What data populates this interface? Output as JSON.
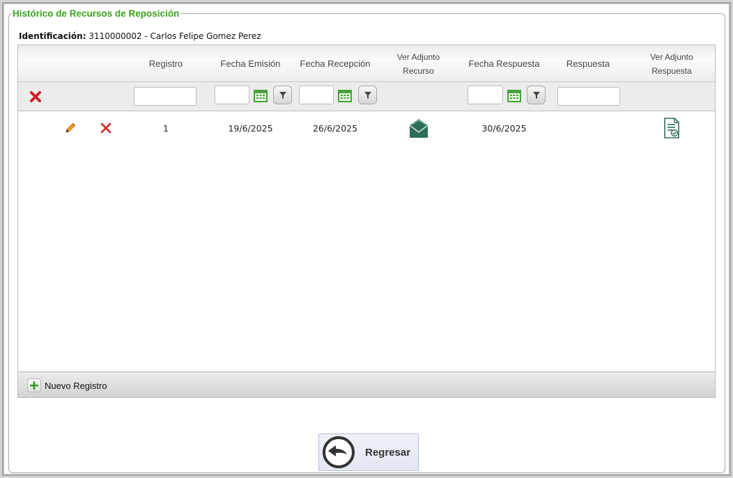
{
  "panel": {
    "title": "Histórico de Recursos de Reposición",
    "identification_label": "Identificación:",
    "identification_value": "3110000002 - Carlos Felipe Gomez Perez"
  },
  "grid": {
    "columns": {
      "registro": "Registro",
      "fecha_emision": "Fecha Emisión",
      "fecha_recepcion": "Fecha Recepción",
      "ver_adjunto_recurso_1": "Ver Adjunto",
      "ver_adjunto_recurso_2": "Recurso",
      "fecha_respuesta": "Fecha Respuesta",
      "respuesta": "Respuesta",
      "ver_adjunto_respuesta_1": "Ver Adjunto",
      "ver_adjunto_respuesta_2": "Respuesta"
    },
    "filters": {
      "registro": "",
      "fecha_emision": "",
      "fecha_recepcion": "",
      "fecha_respuesta": "",
      "respuesta": ""
    },
    "rows": [
      {
        "registro": "1",
        "fecha_emision": "19/6/2025",
        "fecha_recepcion": "26/6/2025",
        "fecha_respuesta": "30/6/2025",
        "respuesta": ""
      }
    ],
    "footer": {
      "add_label": "Nuevo Registro"
    }
  },
  "actions": {
    "back_label": "Regresar"
  },
  "colors": {
    "title_green": "#3aa21a",
    "delete_red": "#e02020",
    "calendar_green": "#46a23a",
    "envelope_teal": "#2d6e58"
  },
  "icons": {
    "edit": "pencil-icon",
    "delete": "delete-x-icon",
    "clear_filters": "clear-filters-icon",
    "calendar": "calendar-icon",
    "filter": "filter-funnel-icon",
    "attachment_recurso": "envelope-icon",
    "attachment_respuesta": "document-check-icon",
    "add": "plus-icon",
    "back": "back-arrow-icon"
  }
}
